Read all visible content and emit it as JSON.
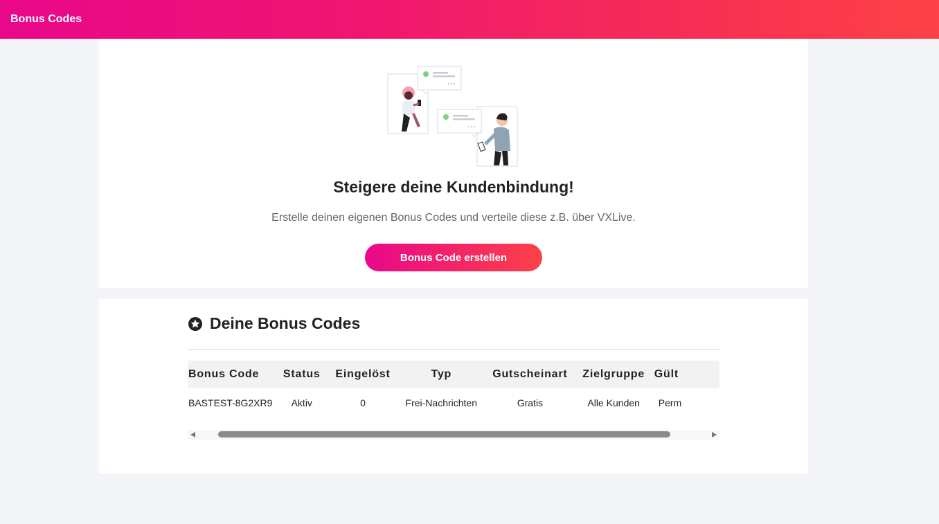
{
  "app": {
    "title": "Bonus Codes",
    "accent_start": "#e9078a",
    "accent_end": "#fd4147"
  },
  "hero": {
    "title": "Steigere deine Kundenbindung!",
    "subtitle": "Erstelle deinen eigenen Bonus Codes und verteile diese z.B. über VXLive.",
    "cta_label": "Bonus Code erstellen",
    "illustration": "two-people-chatting-illustration"
  },
  "codes_section": {
    "icon": "star-circle-icon",
    "title": "Deine Bonus Codes",
    "columns": [
      "Bonus Code",
      "Status",
      "Eingelöst",
      "Typ",
      "Gutscheinart",
      "Zielgruppe",
      "Gült"
    ],
    "rows": [
      [
        "BASTEST-8G2XR9",
        "Aktiv",
        "0",
        "Frei-Nachrichten",
        "Gratis",
        "Alle Kunden",
        "Perm"
      ]
    ]
  }
}
